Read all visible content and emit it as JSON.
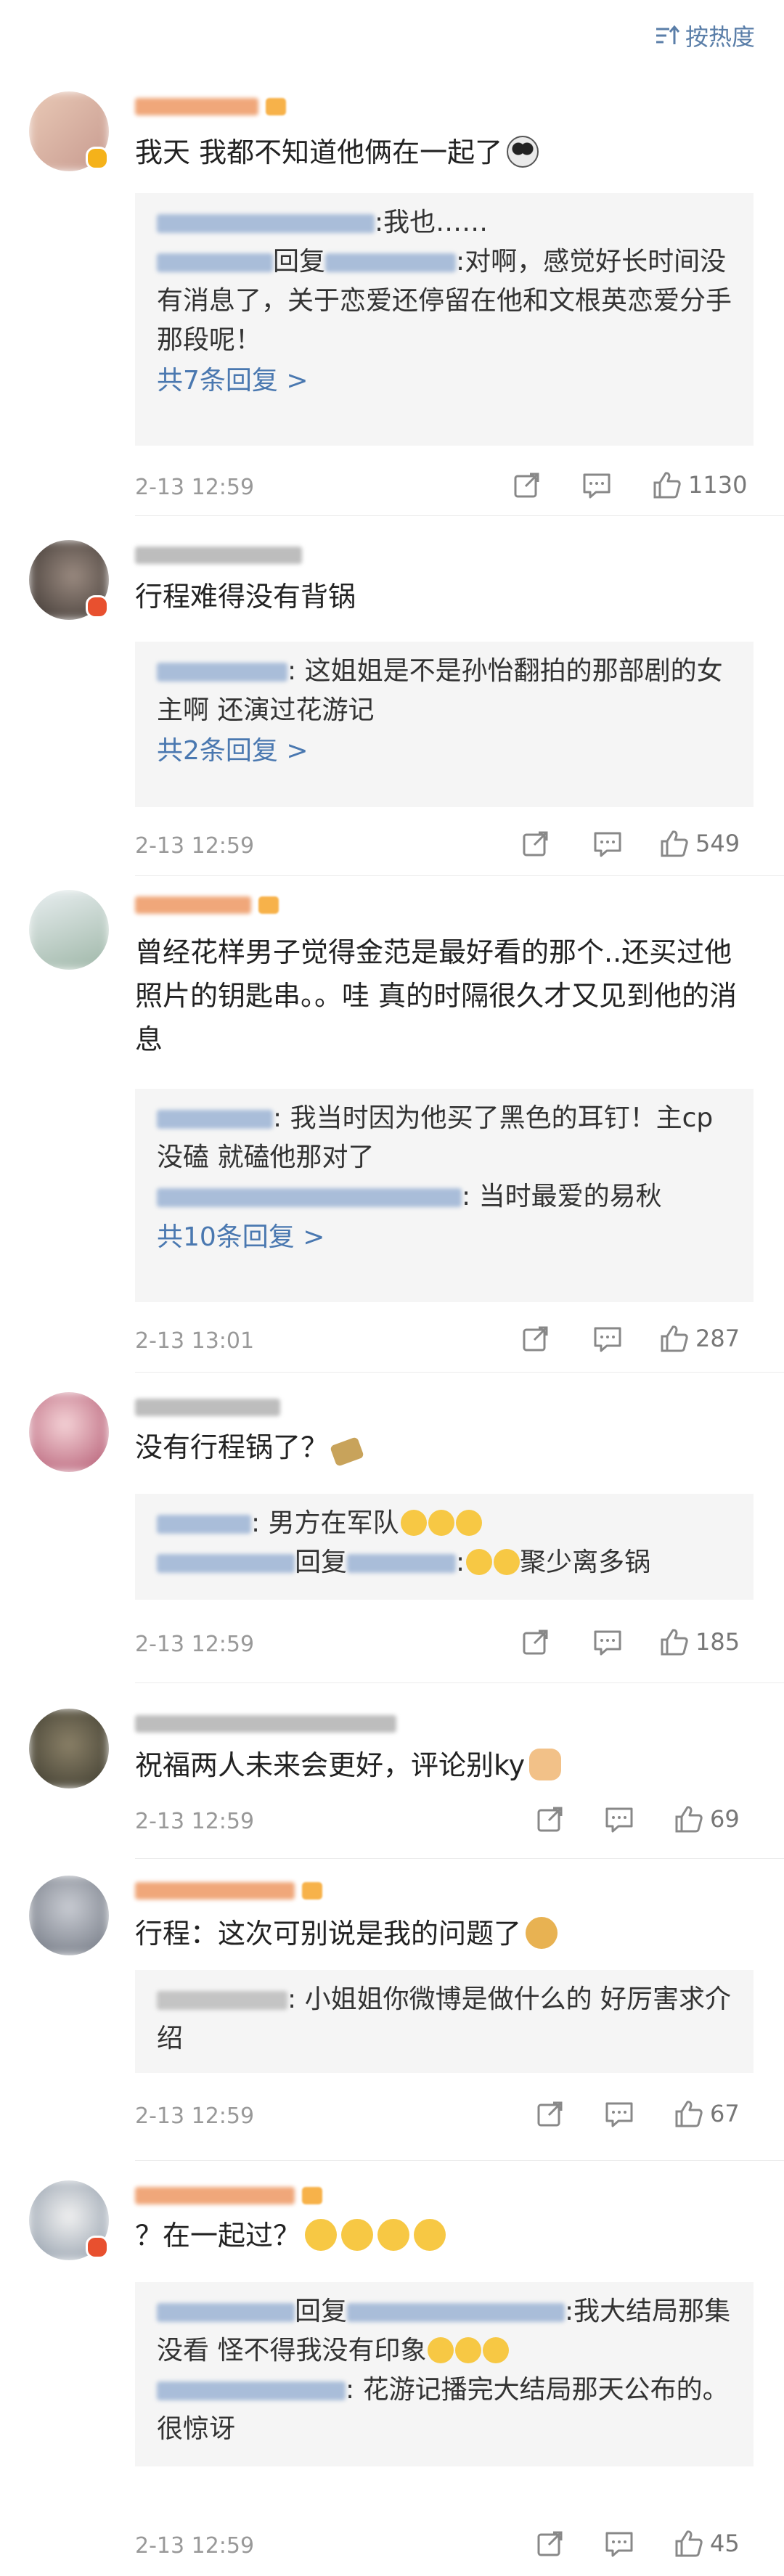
{
  "sort": {
    "label": "按热度"
  },
  "comments": [
    {
      "text": "我天 我都不知道他俩在一起了",
      "replies": [
        {
          "text": ":我也……"
        },
        {
          "prefix": "回复",
          "text": ":对啊，感觉好长时间没有消息了，关于恋爱还停留在他和文根英恋爱分手那段呢！"
        }
      ],
      "more": "共7条回复 >",
      "time": "2-13 12:59",
      "likes": "1130"
    },
    {
      "text": "行程难得没有背锅",
      "replies": [
        {
          "text": ": 这姐姐是不是孙怡翻拍的那部剧的女主啊 还演过花游记"
        }
      ],
      "more": "共2条回复 >",
      "time": "2-13 12:59",
      "likes": "549"
    },
    {
      "text": "曾经花样男子觉得金范是最好看的那个..还买过他照片的钥匙串。。哇 真的时隔很久才又见到他的消息",
      "replies": [
        {
          "text": ": 我当时因为他买了黑色的耳钉！主cp没磕 就磕他那对了"
        },
        {
          "text": ": 当时最爱的易秋"
        }
      ],
      "more": "共10条回复 >",
      "time": "2-13 13:01",
      "likes": "287"
    },
    {
      "text": "没有行程锅了？",
      "replies": [
        {
          "text": ": 男方在军队"
        },
        {
          "prefix": "回复",
          "text": ":"
        },
        {
          "text": "聚少离多锅"
        }
      ],
      "more": "",
      "time": "2-13 12:59",
      "likes": "185"
    },
    {
      "text": "祝福两人未来会更好，评论别ky",
      "replies": [],
      "more": "",
      "time": "2-13 12:59",
      "likes": "69"
    },
    {
      "text": "行程：这次可别说是我的问题了",
      "replies": [
        {
          "text": ": 小姐姐你微博是做什么的 好厉害求介绍"
        }
      ],
      "more": "",
      "time": "2-13 12:59",
      "likes": "67"
    },
    {
      "text": "？在一起过？",
      "replies": [
        {
          "prefix": "回复",
          "text": ":我大结局那集没看 怪不得我没有印象"
        },
        {
          "text": ": 花游记播完大结局那天公布的。很惊讶"
        }
      ],
      "more": "",
      "time": "2-13 12:59",
      "likes": "45"
    }
  ],
  "colors": {
    "link": "#4a78b0",
    "meta": "#999999",
    "replyBg": "#f5f5f5",
    "sort": "#5a7ea8"
  },
  "icons": [
    "sort-icon",
    "share-icon",
    "comment-icon",
    "like-icon"
  ]
}
